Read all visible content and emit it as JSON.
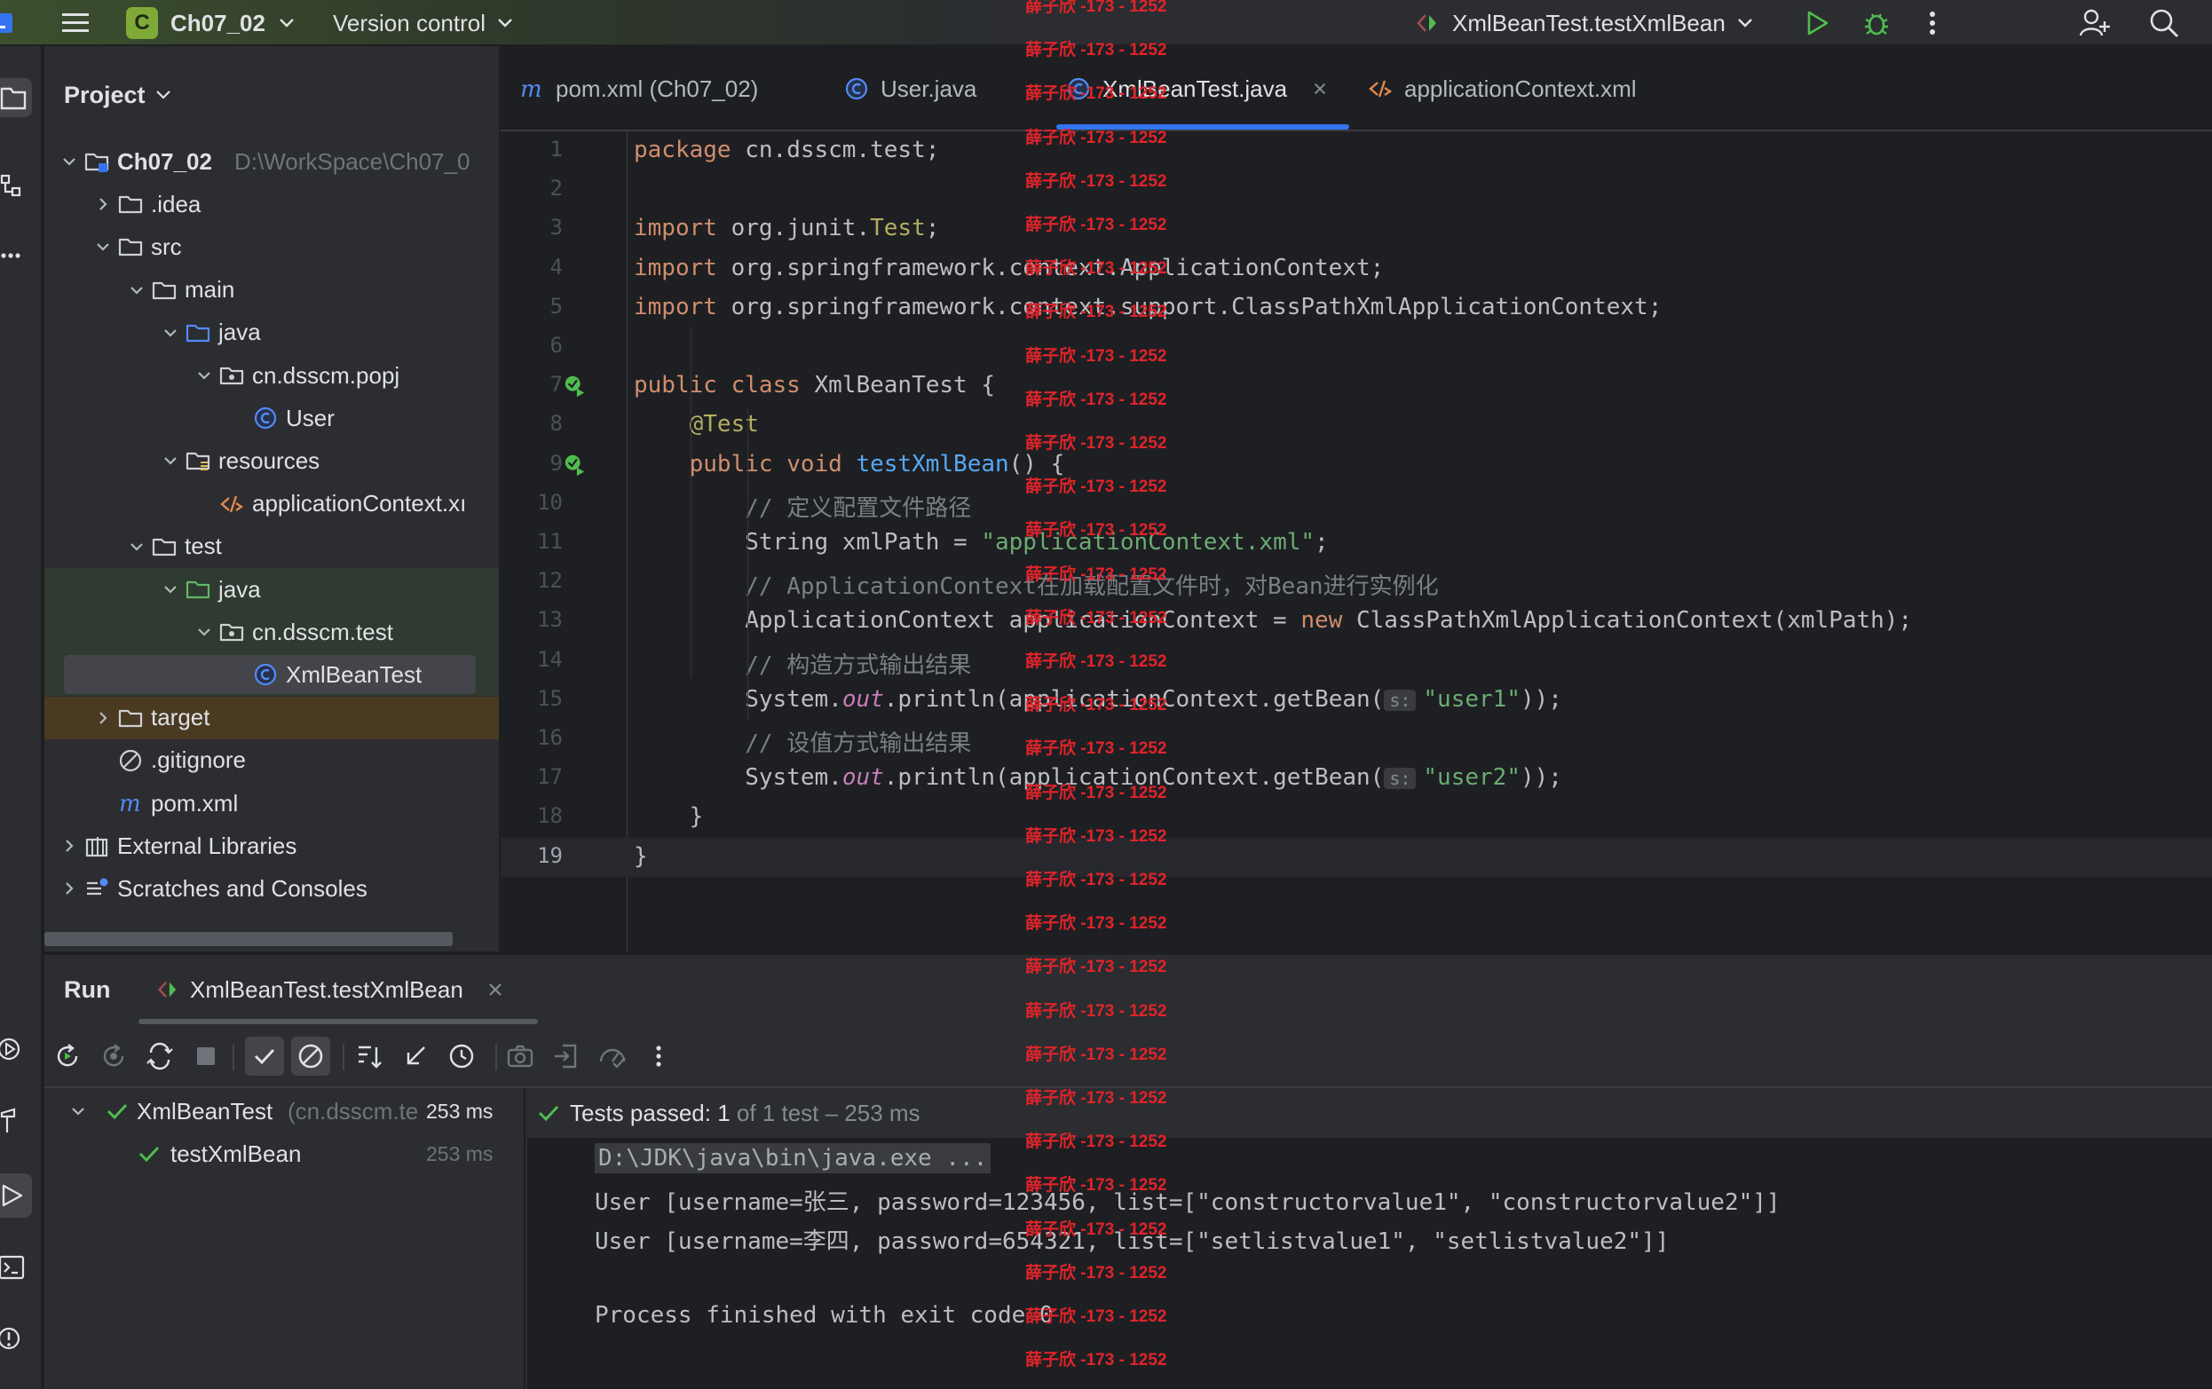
{
  "titlebar": {
    "project_badge": "C",
    "project_name": "Ch07_02",
    "vcs_label": "Version control",
    "run_config": "XmlBeanTest.testXmlBean",
    "accent": "#4fbd50"
  },
  "project_pane": {
    "title": "Project",
    "tree": [
      {
        "label": "Ch07_02",
        "hint": "D:\\WorkSpace\\Ch07_0",
        "icon": "module-folder-icon",
        "expanded": true
      },
      {
        "label": ".idea",
        "icon": "folder-icon",
        "expanded": false
      },
      {
        "label": "src",
        "icon": "folder-icon",
        "expanded": true
      },
      {
        "label": "main",
        "icon": "folder-icon",
        "expanded": true
      },
      {
        "label": "java",
        "icon": "source-folder-icon",
        "expanded": true
      },
      {
        "label": "cn.dsscm.popj",
        "icon": "package-icon",
        "expanded": true
      },
      {
        "label": "User",
        "icon": "class-icon"
      },
      {
        "label": "resources",
        "icon": "resources-folder-icon",
        "expanded": true
      },
      {
        "label": "applicationContext.xı",
        "icon": "xml-file-icon"
      },
      {
        "label": "test",
        "icon": "folder-icon",
        "expanded": true
      },
      {
        "label": "java",
        "icon": "test-source-folder-icon",
        "expanded": true
      },
      {
        "label": "cn.dsscm.test",
        "icon": "package-icon",
        "expanded": true
      },
      {
        "label": "XmlBeanTest",
        "icon": "class-icon",
        "selected": true
      },
      {
        "label": "target",
        "icon": "folder-icon",
        "expanded": false
      },
      {
        "label": ".gitignore",
        "icon": "ignore-file-icon"
      },
      {
        "label": "pom.xml",
        "icon": "maven-icon"
      },
      {
        "label": "External Libraries",
        "icon": "library-icon",
        "expanded": false
      },
      {
        "label": "Scratches and Consoles",
        "icon": "scratches-icon",
        "expanded": false
      }
    ]
  },
  "editor": {
    "tabs": [
      {
        "label": "pom.xml (Ch07_02)",
        "icon": "maven-icon"
      },
      {
        "label": "User.java",
        "icon": "class-icon"
      },
      {
        "label": "XmlBeanTest.java",
        "icon": "class-icon",
        "active": true
      },
      {
        "label": "applicationContext.xml",
        "icon": "xml-file-icon"
      }
    ],
    "line_numbers": [
      "1",
      "2",
      "3",
      "4",
      "5",
      "6",
      "7",
      "8",
      "9",
      "10",
      "11",
      "12",
      "13",
      "14",
      "15",
      "16",
      "17",
      "18",
      "19"
    ],
    "code": {
      "l1_kw": "package",
      "l1_rest": " cn.dsscm.test;",
      "l3_kw": "import",
      "l3_a": " org.junit.",
      "l3_b": "Test",
      "l3_c": ";",
      "l4_kw": "import",
      "l4_rest": " org.springframework.context.ApplicationContext;",
      "l5_kw": "import",
      "l5_rest": " org.springframework.context.support.ClassPathXmlApplicationContext;",
      "l7_kw": "public class",
      "l7_rest": " XmlBeanTest {",
      "l8": "@Test",
      "l9_kw": "public void",
      "l9_fn": "testXmlBean",
      "l9_rest": "() {",
      "l10": "// 定义配置文件路径",
      "l11_a": "String xmlPath = ",
      "l11_str": "\"applicationContext.xml\"",
      "l11_c": ";",
      "l12": "// ApplicationContext在加载配置文件时，对Bean进行实例化",
      "l13_a": "ApplicationContext applicationContext = ",
      "l13_kw": "new",
      "l13_b": " ClassPathXmlApplicationContext(xmlPath);",
      "l14": "// 构造方式输出结果",
      "l15_a": "System.",
      "l15_fld": "out",
      "l15_b": ".println(applicationContext.getBean(",
      "l15_hint": "s:",
      "l15_str": "\"user1\"",
      "l15_c": "));",
      "l16": "// 设值方式输出结果",
      "l17_a": "System.",
      "l17_fld": "out",
      "l17_b": ".println(applicationContext.getBean(",
      "l17_hint": "s:",
      "l17_str": "\"user2\"",
      "l17_c": "));",
      "l18": "}",
      "l19": "}"
    }
  },
  "watermark": {
    "text": "薛子欣 -173 - 1252",
    "color": "#e0242b"
  },
  "run_pane": {
    "title": "Run",
    "tab_label": "XmlBeanTest.testXmlBean",
    "tests": [
      {
        "name": "XmlBeanTest",
        "hint": "(cn.dsscm.te",
        "time": "253 ms"
      },
      {
        "name": "testXmlBean",
        "time": "253 ms"
      }
    ],
    "status_bold": "Tests passed: 1",
    "status_rest": " of 1 test – 253 ms",
    "console": [
      "D:\\JDK\\java\\bin\\java.exe ...",
      "User [username=张三, password=123456, list=[\"constructorvalue1\", \"constructorvalue2\"]]",
      "User [username=李四, password=654321, list=[\"setlistvalue1\", \"setlistvalue2\"]]",
      "",
      "Process finished with exit code 0"
    ]
  }
}
